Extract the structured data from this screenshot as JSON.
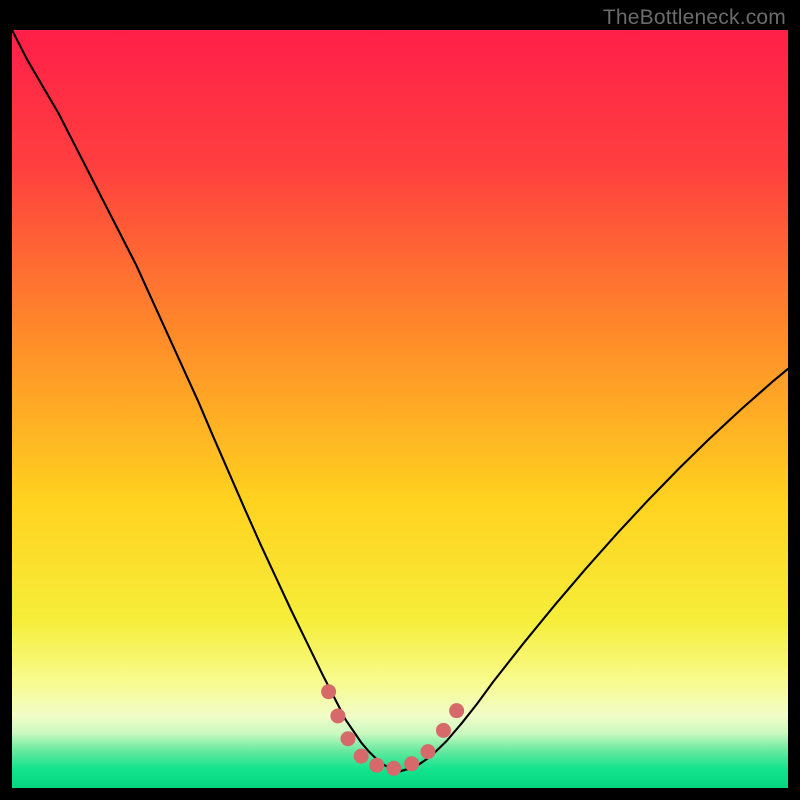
{
  "watermark": "TheBottleneck.com",
  "chart_data": {
    "type": "line",
    "title": "",
    "xlabel": "",
    "ylabel": "",
    "xlim": [
      0,
      100
    ],
    "ylim": [
      0,
      100
    ],
    "gradient_stops": [
      {
        "offset": 0.0,
        "color": "#ff1f49"
      },
      {
        "offset": 0.18,
        "color": "#ff3f3f"
      },
      {
        "offset": 0.4,
        "color": "#ff8a2a"
      },
      {
        "offset": 0.62,
        "color": "#ffd21f"
      },
      {
        "offset": 0.78,
        "color": "#f6ee3a"
      },
      {
        "offset": 0.86,
        "color": "#f8fb8f"
      },
      {
        "offset": 0.905,
        "color": "#f1fcc8"
      },
      {
        "offset": 0.928,
        "color": "#c9f9c0"
      },
      {
        "offset": 0.95,
        "color": "#6be9a0"
      },
      {
        "offset": 0.975,
        "color": "#12e38d"
      },
      {
        "offset": 1.0,
        "color": "#05d781"
      }
    ],
    "series": [
      {
        "name": "bottleneck-curve",
        "stroke": "#000000",
        "stroke_width": 2.1,
        "x": [
          0,
          2,
          4,
          6,
          8,
          10,
          12,
          14,
          16,
          18,
          20,
          22,
          24,
          26,
          28,
          30,
          32,
          34,
          36,
          38,
          40,
          41,
          42,
          43,
          44,
          45,
          46,
          47,
          48,
          50,
          52,
          54,
          56,
          58,
          60,
          62,
          66,
          70,
          74,
          78,
          82,
          86,
          90,
          94,
          98,
          100
        ],
        "y": [
          100,
          96,
          92.5,
          89,
          85,
          81,
          77,
          73,
          69,
          64.5,
          60,
          55.5,
          51,
          46.2,
          41.5,
          36.8,
          32.2,
          27.8,
          23.4,
          19.2,
          15,
          13,
          11,
          9,
          7.5,
          6,
          4.8,
          3.8,
          3,
          2.2,
          2.8,
          4.2,
          6.2,
          8.6,
          11.2,
          14,
          19.2,
          24.2,
          29,
          33.6,
          38,
          42.2,
          46.2,
          50,
          53.6,
          55.3
        ]
      }
    ],
    "markers": {
      "name": "highlight-points",
      "fill": "#d66a6a",
      "stroke": "#d66a6a",
      "radius": 7,
      "points": [
        {
          "x": 40.8,
          "y": 12.7
        },
        {
          "x": 42.0,
          "y": 9.5
        },
        {
          "x": 43.3,
          "y": 6.5
        },
        {
          "x": 45.0,
          "y": 4.2
        },
        {
          "x": 47.0,
          "y": 3.0
        },
        {
          "x": 49.2,
          "y": 2.6
        },
        {
          "x": 51.5,
          "y": 3.2
        },
        {
          "x": 53.6,
          "y": 4.8
        },
        {
          "x": 55.6,
          "y": 7.6
        },
        {
          "x": 57.3,
          "y": 10.2
        }
      ]
    }
  }
}
